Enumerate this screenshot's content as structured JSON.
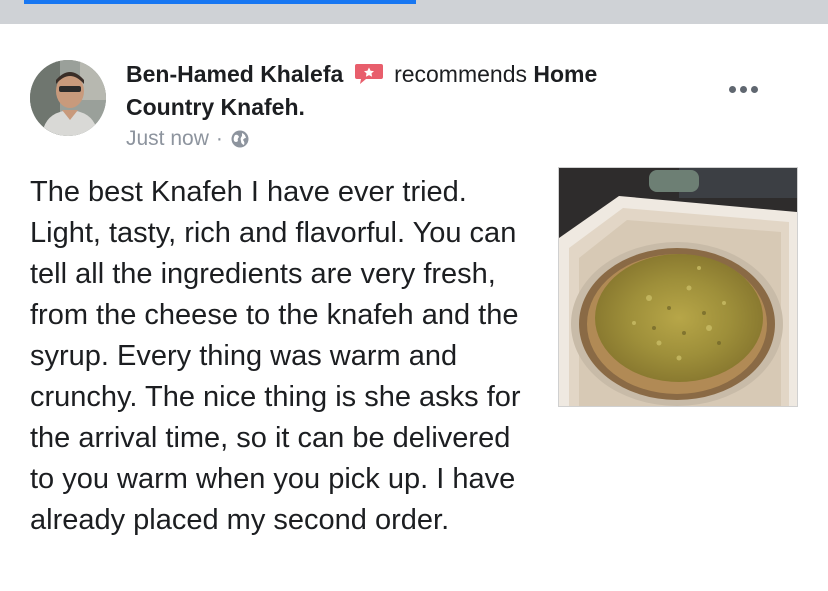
{
  "post": {
    "author_name": "Ben-Hamed Khalefa",
    "action_text": "recommends",
    "page_name_line1": "Home",
    "page_name_line2": "Country Knafeh.",
    "timestamp": "Just now",
    "separator": "·",
    "privacy_icon": "globe-icon",
    "recommend_icon": "recommend-badge-icon",
    "more_icon": "more-horizontal-icon",
    "review_text": "The best Knafeh I have ever tried. Light, tasty, rich and flavorful. You can tell all the ingredients are very fresh, from the cheese to the knafeh and the syrup. Every thing was warm and crunchy. The nice thing is she asks for the arrival time, so it can be delivered to you warm when you pick up. I have already placed my second order."
  },
  "colors": {
    "accent": "#1877f2",
    "text_primary": "#1c1e21",
    "text_secondary": "#8d949e",
    "recommend_badge": "#e85e6c",
    "top_strip": "#cfd2d6"
  }
}
